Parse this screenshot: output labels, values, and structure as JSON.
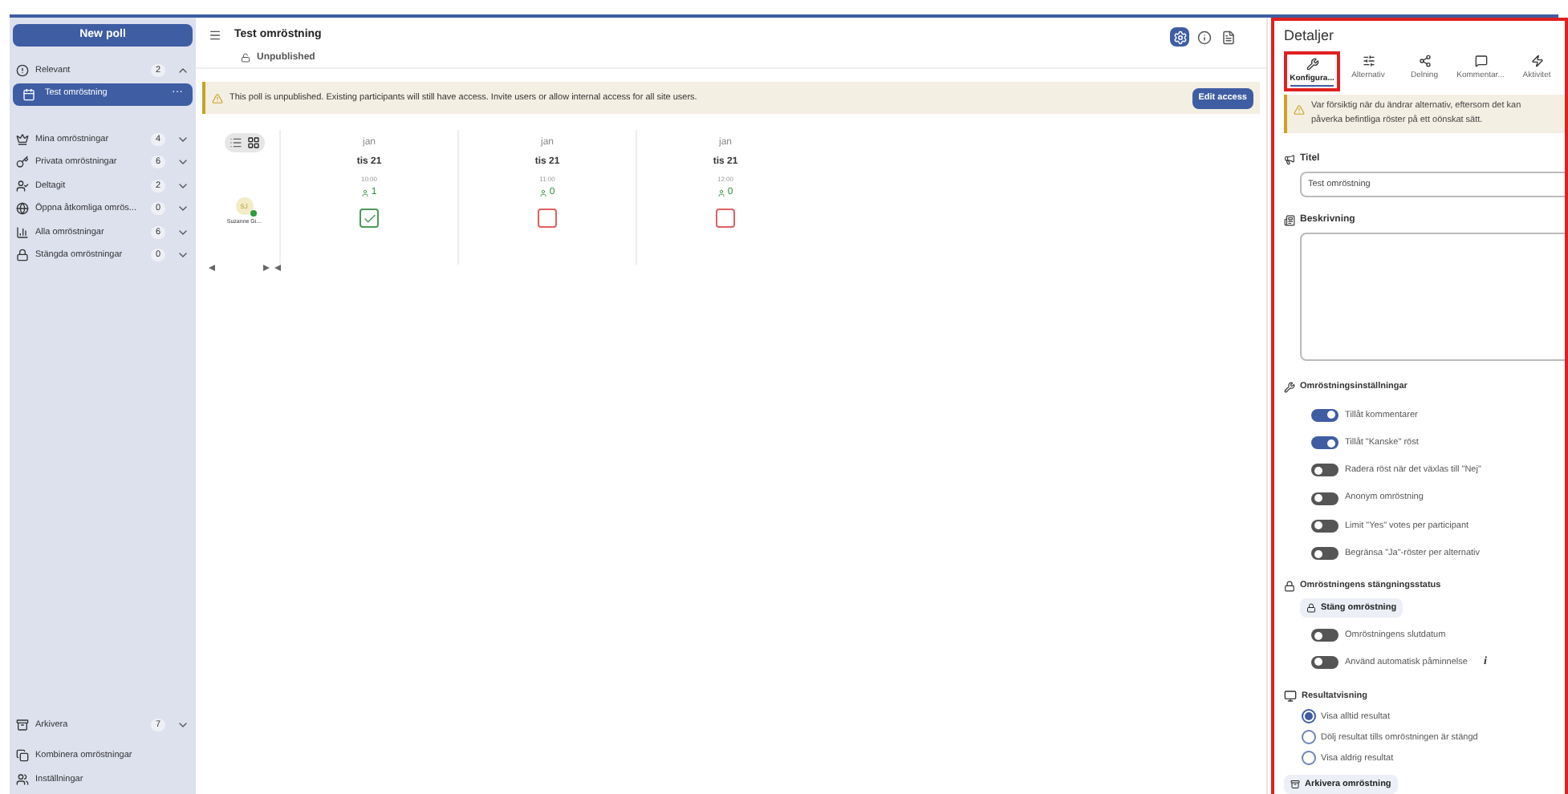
{
  "sidebar": {
    "new_button": "New poll",
    "groups": [
      {
        "label": "Relevant",
        "count": "2",
        "expanded": true,
        "children": [
          {
            "label": "Test omröstning",
            "selected": true,
            "menu": "···"
          }
        ]
      },
      {
        "label": "Mina omröstningar",
        "count": "4",
        "expanded": false
      },
      {
        "label": "Privata omröstningar",
        "count": "6",
        "expanded": false
      },
      {
        "label": "Deltagit",
        "count": "2",
        "expanded": false
      },
      {
        "label": "Öppna åtkomliga omrös...",
        "count": "0",
        "expanded": false
      },
      {
        "label": "Alla omröstningar",
        "count": "6",
        "expanded": false
      },
      {
        "label": "Stängda omröstningar",
        "count": "0",
        "expanded": false
      }
    ],
    "bottom": [
      {
        "label": "Arkivera",
        "count": "7",
        "expanded": false
      },
      {
        "label": "Kombinera omröstningar"
      },
      {
        "label": "Inställningar"
      }
    ]
  },
  "main": {
    "title": "Test omröstning",
    "status": "Unpublished",
    "toolbar": [
      {
        "selected": true
      },
      {
        "selected": false
      },
      {
        "selected": false
      }
    ],
    "banner": {
      "text": "This poll is unpublished. Existing participants will still have access. Invite users or allow internal access for all site users.",
      "button": "Edit access"
    },
    "view_toggle": [
      {
        "selected": false
      },
      {
        "selected": true
      }
    ],
    "options": [
      {
        "month": "jan",
        "day": "tis 21",
        "time": "10:00",
        "count": "1"
      },
      {
        "month": "jan",
        "day": "tis 21",
        "time": "11:00",
        "count": "0"
      },
      {
        "month": "jan",
        "day": "tis 21",
        "time": "12:00",
        "count": "0"
      }
    ],
    "participants": [
      {
        "initials": "SJ",
        "name": "Suzanne Gi...",
        "online": true,
        "votes": [
          {
            "checked": true
          },
          {
            "checked": false
          },
          {
            "checked": false
          }
        ]
      }
    ]
  },
  "details": {
    "title": "Detaljer",
    "tabs": [
      {
        "label": "Konfigura...",
        "selected": true
      },
      {
        "label": "Alternativ",
        "selected": false
      },
      {
        "label": "Delning",
        "selected": false
      },
      {
        "label": "Kommentar...",
        "selected": false
      },
      {
        "label": "Aktivitet",
        "selected": false
      }
    ],
    "warning": "Var försiktig när du ändrar alternativ, eftersom det kan påverka befintliga röster på ett oönskat sätt.",
    "title_label": "Titel",
    "title_value": "Test omröstning",
    "description_label": "Beskrivning",
    "settings_heading": "Omröstningsinställningar",
    "settings": [
      {
        "label": "Tillåt kommentarer",
        "on": true
      },
      {
        "label": "Tillåt \"Kanske\" röst",
        "on": true
      },
      {
        "label": "Radera röst när det växlas till \"Nej\"",
        "on": false
      },
      {
        "label": "Anonym omröstning",
        "on": false
      },
      {
        "label": "Limit \"Yes\" votes per participant",
        "on": false
      },
      {
        "label": "Begränsa \"Ja\"-röster per alternativ",
        "on": false
      }
    ],
    "closing_heading": "Omröstningens stängningsstatus",
    "close_button": "Stäng omröstning",
    "closing": [
      {
        "label": "Omröstningens slutdatum",
        "on": false
      },
      {
        "label": "Använd automatisk påminnelse",
        "on": false,
        "info": "i"
      }
    ],
    "results_heading": "Resultatvisning",
    "results": [
      {
        "label": "Visa alltid resultat",
        "selected": true
      },
      {
        "label": "Dölj resultat tills omröstningen är stängd",
        "selected": false
      },
      {
        "label": "Visa aldrig resultat",
        "selected": false
      }
    ],
    "archive_button": "Arkivera omröstning"
  }
}
